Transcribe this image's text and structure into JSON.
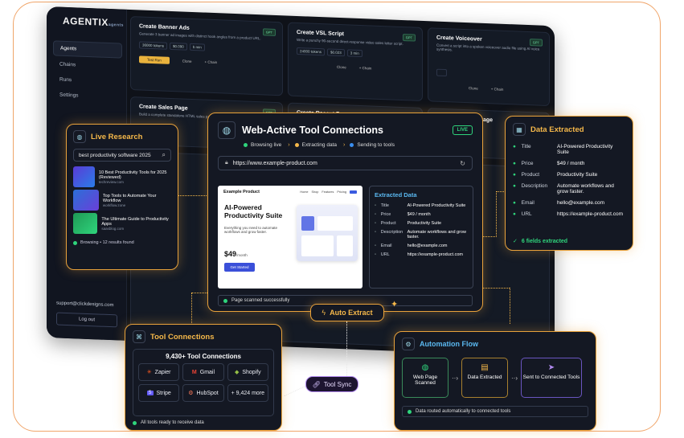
{
  "app": {
    "logo": "AGENTIX",
    "logo_sub": "agents",
    "nav": [
      "Agents",
      "Chains",
      "Runs",
      "Settings"
    ],
    "support": "support@clickdesigns.com",
    "logout": "Log out"
  },
  "cards": [
    {
      "title": "Create Banner Ads",
      "desc": "Generate 3 banner ad images with distinct hook angles from a product URL.",
      "tokens": "36000 tokens",
      "cost": "$0.090",
      "time": "5 min",
      "tag": "GPT",
      "test": "Test Run",
      "clone": "Clone",
      "chain": "+ Chain"
    },
    {
      "title": "Create VSL Script",
      "desc": "Write a punchy 90-second direct-response video sales letter script.",
      "tokens": "24000 tokens",
      "cost": "$0.023",
      "time": "3 min",
      "tag": "GPT",
      "clone": "Clone",
      "chain": "+ Chain"
    },
    {
      "title": "Create Voiceover",
      "desc": "Convert a script into a spoken voiceover audio file using AI voice synthesis.",
      "tag": "GPT",
      "clone": "Clone",
      "chain": "+ Chain"
    },
    {
      "title": "Create Sales Page",
      "desc": "Build a complete standalone HTML sales page ready to deploy.",
      "tag": "GPT"
    },
    {
      "title": "Create Recent Page",
      "tag": "GPT"
    },
    {
      "title": "JV Recruitment Page"
    }
  ],
  "live_research": {
    "title": "Live Research",
    "query": "best productivity software 2025",
    "results": [
      {
        "title": "10 Best Productivity Tools for 2025 (Reviewed)",
        "source": "techreview.com"
      },
      {
        "title": "Top Tools to Automate Your Workflow",
        "source": "workflow.zone"
      },
      {
        "title": "The Ultimate Guide to Productivity Apps",
        "source": "saasblog.com"
      }
    ],
    "status": "Browsing • 12 results found"
  },
  "main": {
    "title": "Web-Active Tool Connections",
    "live": "LIVE",
    "steps": [
      "Browsing live",
      "Extracting data",
      "Sending to tools"
    ],
    "url": "https://www.example-product.com",
    "preview": {
      "brand": "Example Product",
      "nav": [
        "Home",
        "Shop",
        "Features",
        "Pricing"
      ],
      "heading": "AI-Powered Productivity Suite",
      "sub": "Everything you need to automate workflows and grow faster.",
      "price": "$49",
      "per": "/month",
      "cta": "Get Started"
    },
    "extracted_title": "Extracted Data",
    "extracted": [
      [
        "Title",
        "AI-Powered Productivity Suite"
      ],
      [
        "Price",
        "$49 / month"
      ],
      [
        "Product",
        "Productivity Suite"
      ],
      [
        "Description",
        "Automate workflows and grow faster."
      ],
      [
        "Email",
        "hello@example.com"
      ],
      [
        "URL",
        "https://example-product.com"
      ]
    ],
    "status": "Page scanned successfully"
  },
  "data_extracted": {
    "title": "Data Extracted",
    "fields": [
      [
        "Title",
        "AI-Powered Productivity Suite"
      ],
      [
        "Price",
        "$49 / month"
      ],
      [
        "Product",
        "Productivity Suite"
      ],
      [
        "Description",
        "Automate workflows and grow faster."
      ],
      [
        "Email",
        "hello@example.com"
      ],
      [
        "URL",
        "https://example-product.com"
      ]
    ],
    "footer": "6 fields extracted"
  },
  "auto_extract": "Auto Extract",
  "tool_connections": {
    "title": "Tool Connections",
    "count": "9,430+ Tool Connections",
    "tools": [
      "Zapier",
      "Gmail",
      "Shopify",
      "Stripe",
      "HubSpot",
      "+ 9,424 more"
    ],
    "status": "All tools ready to receive data"
  },
  "tool_sync": "Tool Sync",
  "automation": {
    "title": "Automation Flow",
    "steps": [
      "Web Page Scanned",
      "Data Extracted",
      "Sent to Connected Tools"
    ],
    "status": "Data routed automatically to connected tools"
  },
  "colors": {
    "accent": "#f5b84a",
    "green": "#2fd47c",
    "bg": "#141823"
  }
}
